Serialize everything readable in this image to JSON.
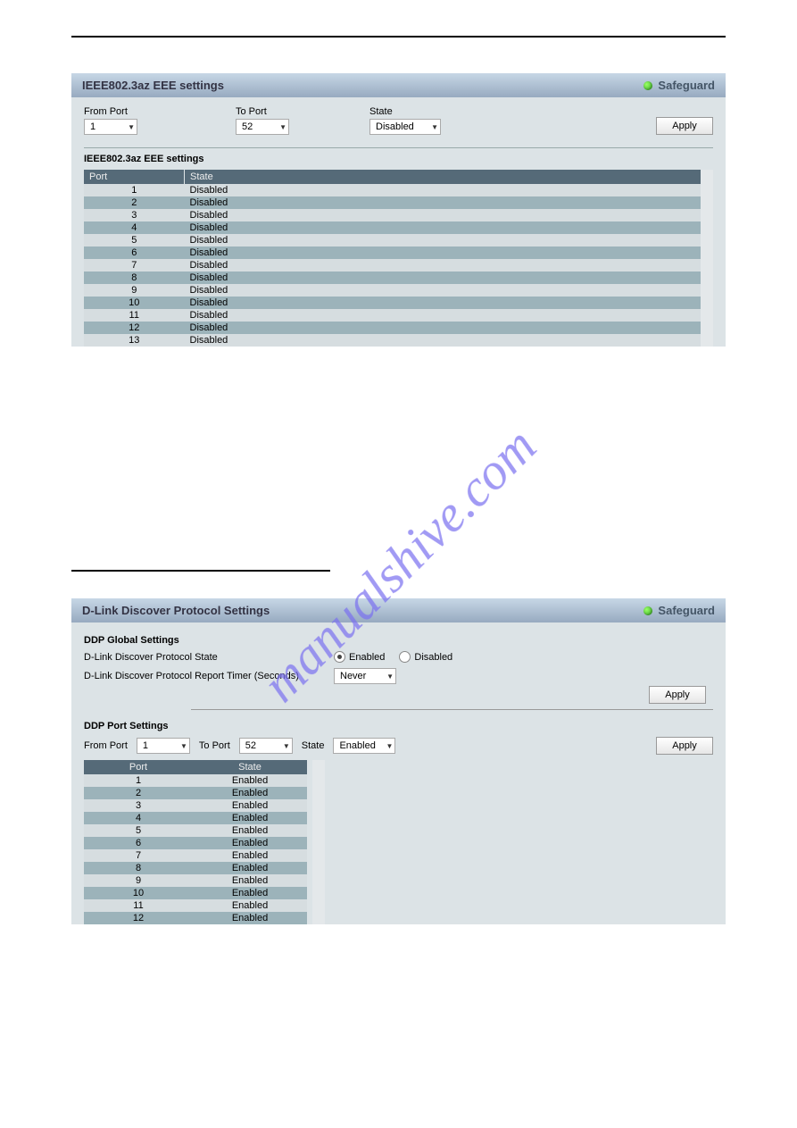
{
  "safeguard_label": "Safeguard",
  "apply_label": "Apply",
  "watermark_text": "manualshive.com",
  "panel1": {
    "title": "IEEE802.3az EEE settings",
    "from_port_label": "From Port",
    "from_port_value": "1",
    "to_port_label": "To Port",
    "to_port_value": "52",
    "state_label": "State",
    "state_value": "Disabled",
    "table_title": "IEEE802.3az EEE settings",
    "col_port": "Port",
    "col_state": "State",
    "rows": [
      {
        "port": "1",
        "state": "Disabled"
      },
      {
        "port": "2",
        "state": "Disabled"
      },
      {
        "port": "3",
        "state": "Disabled"
      },
      {
        "port": "4",
        "state": "Disabled"
      },
      {
        "port": "5",
        "state": "Disabled"
      },
      {
        "port": "6",
        "state": "Disabled"
      },
      {
        "port": "7",
        "state": "Disabled"
      },
      {
        "port": "8",
        "state": "Disabled"
      },
      {
        "port": "9",
        "state": "Disabled"
      },
      {
        "port": "10",
        "state": "Disabled"
      },
      {
        "port": "11",
        "state": "Disabled"
      },
      {
        "port": "12",
        "state": "Disabled"
      },
      {
        "port": "13",
        "state": "Disabled"
      }
    ]
  },
  "panel2": {
    "title": "D-Link Discover Protocol Settings",
    "global_heading": "DDP Global Settings",
    "state_label": "D-Link Discover Protocol State",
    "timer_label": "D-Link Discover Protocol Report Timer (Seconds)",
    "enabled_label": "Enabled",
    "disabled_label": "Disabled",
    "timer_value": "Never",
    "port_heading": "DDP Port Settings",
    "from_port_label": "From Port",
    "from_port_value": "1",
    "to_port_label": "To Port",
    "to_port_value": "52",
    "state_ctl_label": "State",
    "state_ctl_value": "Enabled",
    "col_port": "Port",
    "col_state": "State",
    "rows": [
      {
        "port": "1",
        "state": "Enabled"
      },
      {
        "port": "2",
        "state": "Enabled"
      },
      {
        "port": "3",
        "state": "Enabled"
      },
      {
        "port": "4",
        "state": "Enabled"
      },
      {
        "port": "5",
        "state": "Enabled"
      },
      {
        "port": "6",
        "state": "Enabled"
      },
      {
        "port": "7",
        "state": "Enabled"
      },
      {
        "port": "8",
        "state": "Enabled"
      },
      {
        "port": "9",
        "state": "Enabled"
      },
      {
        "port": "10",
        "state": "Enabled"
      },
      {
        "port": "11",
        "state": "Enabled"
      },
      {
        "port": "12",
        "state": "Enabled"
      }
    ]
  }
}
